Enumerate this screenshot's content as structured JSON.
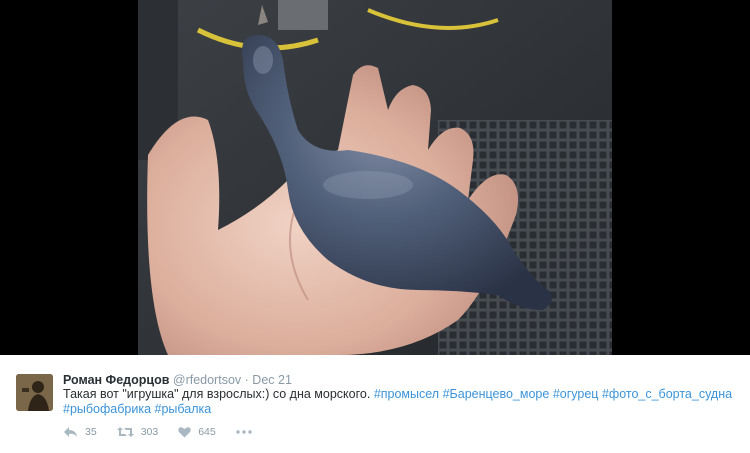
{
  "tweet": {
    "author_name": "Роман Федорцов",
    "handle": "@rfedortsov",
    "separator": "·",
    "date": "Dec 21",
    "text_plain": "Такая вот \"игрушка\" для взрослых:) со дна морского.",
    "hashtags": [
      "#промысел",
      "#Баренцево_море",
      "#огурец",
      "#фото_с_борта_судна",
      "#рыбофабрика",
      "#рыбалка"
    ]
  },
  "actions": {
    "reply_count": "35",
    "retweet_count": "303",
    "like_count": "645",
    "reply_icon": "reply-icon",
    "retweet_icon": "retweet-icon",
    "like_icon": "heart-icon",
    "more_icon": "more-icon"
  },
  "colors": {
    "link": "#3b94d9",
    "text": "#292f33",
    "muted": "#8899a6",
    "icon": "#aab8c2"
  }
}
